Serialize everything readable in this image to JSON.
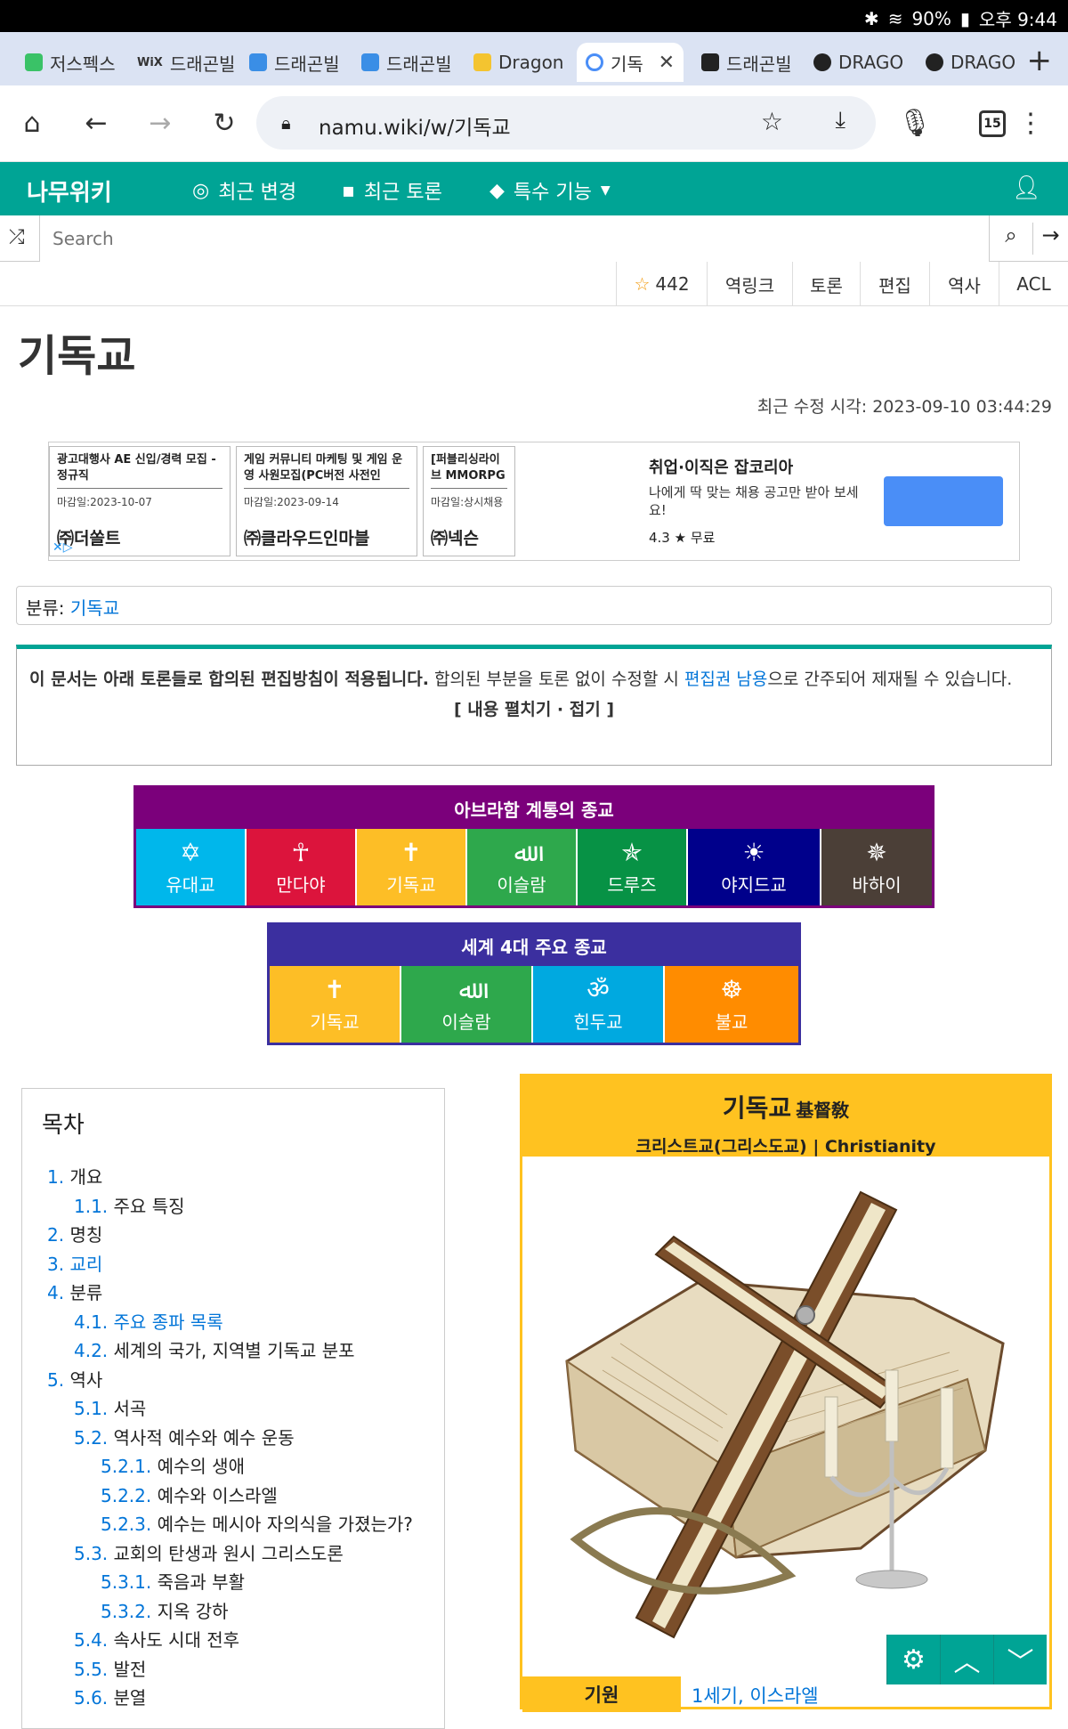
{
  "status": {
    "battery": "90%",
    "time": "오후 9:44"
  },
  "tabs": [
    {
      "title": "저스펙스",
      "color": "#3ac267"
    },
    {
      "title": "드래곤빌",
      "color": "#ffffff",
      "icon_text": "WiX"
    },
    {
      "title": "드래곤빌",
      "color": "#3a8ee6"
    },
    {
      "title": "드래곤빌",
      "color": "#3a8ee6"
    },
    {
      "title": "Dragon",
      "color": "#f4c430"
    },
    {
      "title": "기독",
      "color": "#4a8ef7"
    },
    {
      "title": "드래곤빌",
      "color": "#222222"
    },
    {
      "title": "DRAGO",
      "color": "#222222"
    },
    {
      "title": "DRAGO",
      "color": "#222222"
    }
  ],
  "browser": {
    "url": "namu.wiki/w/기독교",
    "tab_count": "15"
  },
  "site": {
    "logo": "나무위키",
    "nav": [
      "최근 변경",
      "최근 토론",
      "특수 기능"
    ],
    "search_placeholder": "Search"
  },
  "toolbar": {
    "star_count": "442",
    "items": [
      "역링크",
      "토론",
      "편집",
      "역사",
      "ACL"
    ]
  },
  "page": {
    "title": "기독교",
    "modified": "최근 수정 시각: 2023-09-10 03:44:29",
    "category_label": "분류: ",
    "category_link": "기독교"
  },
  "ad": {
    "cards": [
      {
        "title": "광고대행사 AE 신입/경력 모집 - 정규직",
        "deadline": "마감일:2023-10-07",
        "company": "㈜더쏠트"
      },
      {
        "title": "게임 커뮤니티 마케팅 및 게임 운영 사원모집(PC버전 사전인",
        "deadline": "마감일:2023-09-14",
        "company": "㈜클라우드인마블"
      },
      {
        "title": "[퍼블리싱라이브 MMORPG 게임",
        "deadline": "마감일:상시채용",
        "company": "㈜넥슨"
      }
    ],
    "right_title": "취업·이직은 잡코리아",
    "right_desc": "나에게 딱 맞는 채용 공고만 받아 보세요!",
    "right_rating": "4.3 ★   무료"
  },
  "notice": {
    "bold": "이 문서는 아래 토론들로 합의된 편집방침이 적용됩니다.",
    "text1": " 합의된 부분을 토론 없이 수정할 시 ",
    "link": "편집권 남용",
    "text2": "으로 간주되어 제재될 수 있습니다.",
    "toggle": "[ 내용 펼치기 · 접기 ]"
  },
  "abrahamic": {
    "title": "아브라함 계통의 종교",
    "colors": {
      "border": "#7b007b"
    },
    "items": [
      {
        "label": "유대교",
        "icon": "✡",
        "color": "#00b7eb"
      },
      {
        "label": "만다야",
        "icon": "☥",
        "color": "#dc143c"
      },
      {
        "label": "기독교",
        "icon": "✝",
        "color": "#fdbe26"
      },
      {
        "label": "이슬람",
        "icon": "ﷲ",
        "color": "#2ea84c"
      },
      {
        "label": "드루즈",
        "icon": "✯",
        "color": "#079245"
      },
      {
        "label": "야지드교",
        "icon": "☀",
        "color": "#00008b"
      },
      {
        "label": "바하이",
        "icon": "✵",
        "color": "#4b3f37"
      }
    ]
  },
  "major4": {
    "title": "세계 4대 주요 종교",
    "colors": {
      "border": "#3b2f9f"
    },
    "items": [
      {
        "label": "기독교",
        "icon": "✝",
        "color": "#fdbe26"
      },
      {
        "label": "이슬람",
        "icon": "ﷲ",
        "color": "#2ea84c"
      },
      {
        "label": "힌두교",
        "icon": "ॐ",
        "color": "#00a9e0"
      },
      {
        "label": "불교",
        "icon": "☸",
        "color": "#ff8c00"
      }
    ]
  },
  "toc": {
    "title": "목차",
    "items": [
      {
        "num": "1.",
        "label": "개요",
        "level": 0,
        "link": false
      },
      {
        "num": "1.1.",
        "label": "주요 특징",
        "level": 1,
        "link": false
      },
      {
        "num": "2.",
        "label": "명칭",
        "level": 0,
        "link": false
      },
      {
        "num": "3.",
        "label": "교리",
        "level": 0,
        "link": true
      },
      {
        "num": "4.",
        "label": "분류",
        "level": 0,
        "link": false
      },
      {
        "num": "4.1.",
        "label": "주요 종파 목록",
        "level": 1,
        "link": true
      },
      {
        "num": "4.2.",
        "label": "세계의 국가, 지역별 기독교 분포",
        "level": 1,
        "link": false
      },
      {
        "num": "5.",
        "label": "역사",
        "level": 0,
        "link": false
      },
      {
        "num": "5.1.",
        "label": "서곡",
        "level": 1,
        "link": false
      },
      {
        "num": "5.2.",
        "label": "역사적 예수와 예수 운동",
        "level": 1,
        "link": false
      },
      {
        "num": "5.2.1.",
        "label": "예수의 생애",
        "level": 2,
        "link": false
      },
      {
        "num": "5.2.2.",
        "label": "예수와 이스라엘",
        "level": 2,
        "link": false
      },
      {
        "num": "5.2.3.",
        "label": "예수는 메시아 자의식을 가졌는가?",
        "level": 2,
        "link": false
      },
      {
        "num": "5.3.",
        "label": "교회의 탄생과 원시 그리스도론",
        "level": 1,
        "link": false
      },
      {
        "num": "5.3.1.",
        "label": "죽음과 부활",
        "level": 2,
        "link": false
      },
      {
        "num": "5.3.2.",
        "label": "지옥 강하",
        "level": 2,
        "link": false
      },
      {
        "num": "5.4.",
        "label": "속사도 시대 전후",
        "level": 1,
        "link": false
      },
      {
        "num": "5.5.",
        "label": "발전",
        "level": 1,
        "link": false
      },
      {
        "num": "5.6.",
        "label": "분열",
        "level": 1,
        "link": false
      }
    ]
  },
  "infobox": {
    "name": "기독교",
    "hanja": "基督敎",
    "subtitle": "크리스트교(그리스도교) | Christianity",
    "origin_label": "기원",
    "origin_value": "1세기, 이스라엘"
  }
}
